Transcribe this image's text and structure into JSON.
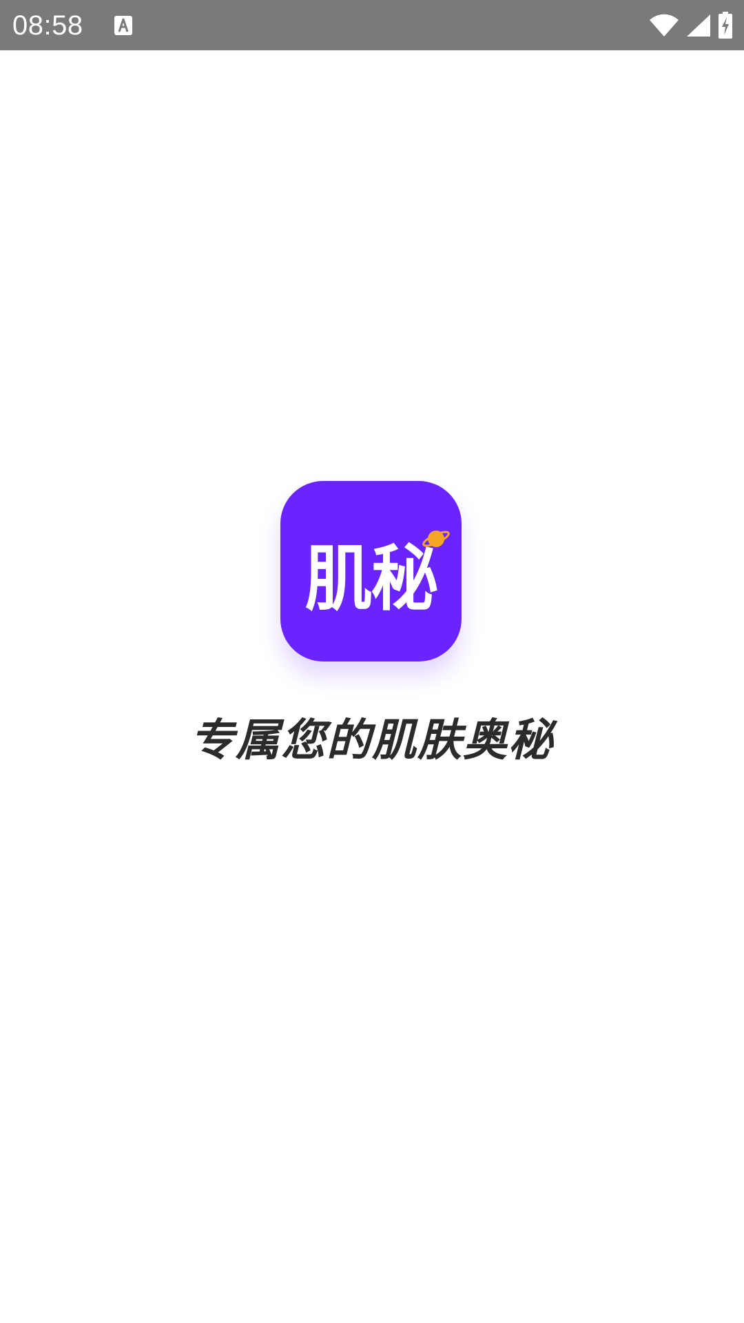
{
  "status_bar": {
    "time": "08:58",
    "notification_icon": "keyboard-a-icon",
    "icons": [
      "wifi-icon",
      "signal-icon",
      "battery-charging-icon"
    ]
  },
  "splash": {
    "logo_text": "肌秘",
    "slogan": "专属您的肌肤奥秘"
  },
  "colors": {
    "status_bar_bg": "#7a7a7a",
    "brand_purple": "#6a24ff",
    "accent_orange": "#f5a623",
    "slogan_text": "#2b2b2b",
    "background": "#ffffff"
  }
}
